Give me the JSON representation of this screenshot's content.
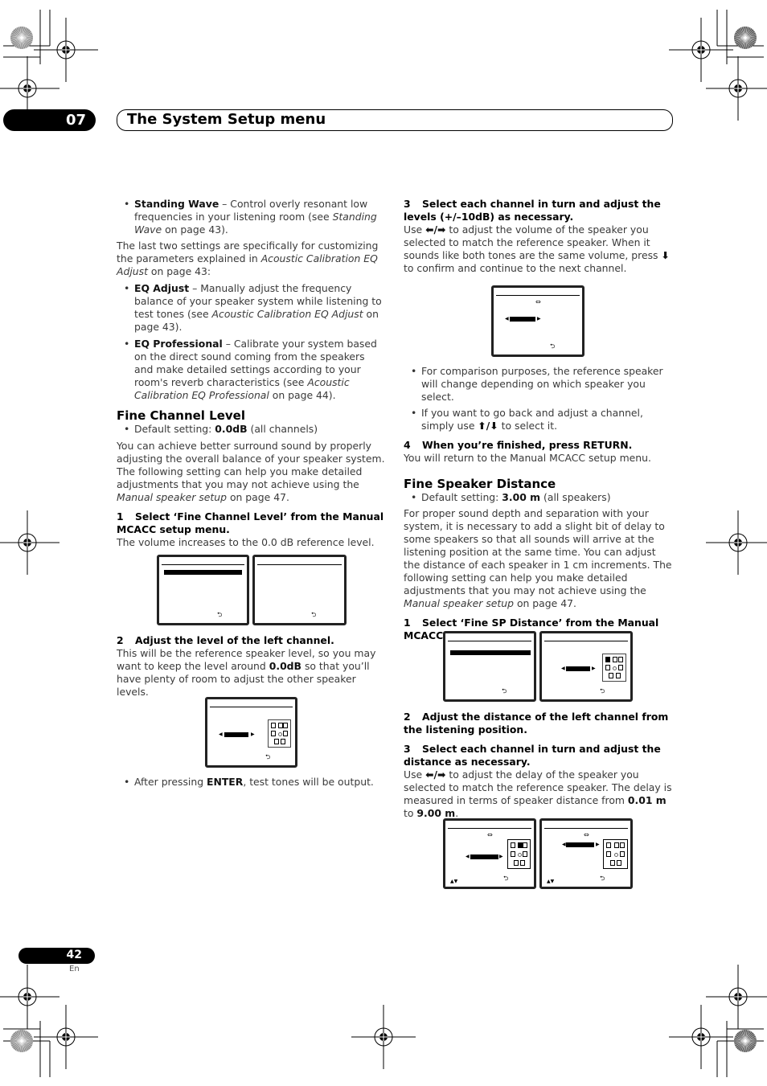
{
  "header": {
    "chapter_number": "07",
    "chapter_title": "The System Setup menu"
  },
  "footer": {
    "page_number": "42",
    "language": "En"
  },
  "left_column": {
    "bullets_top": [
      {
        "bold": "Standing Wave",
        "text": " – Control overly resonant low frequencies in your listening room (see ",
        "ital": "Standing Wave",
        "tail": " on page 43)."
      }
    ],
    "para_last_two": {
      "text": "The last two settings are specifically for customizing the parameters explained in ",
      "ital": "Acoustic Calibration EQ Adjust",
      "tail": " on page 43:"
    },
    "bullets_eq": [
      {
        "bold": "EQ Adjust",
        "text": " – Manually adjust the frequency balance of your speaker system while listening to test tones (see ",
        "ital": "Acoustic Calibration EQ Adjust",
        "tail": " on page 43)."
      },
      {
        "bold": "EQ Professional",
        "text": " – Calibrate your system based on the direct sound coming from the speakers and make detailed settings according to your room's reverb characteristics (see ",
        "ital": "Acoustic Calibration EQ Professional",
        "tail": " on page 44)."
      }
    ],
    "fine_channel_level": {
      "heading": "Fine Channel Level",
      "default_label": "Default setting: ",
      "default_value": "0.0dB",
      "default_tail": " (all channels)",
      "intro": "You can achieve better surround sound by properly adjusting the overall balance of your speaker system. The following setting can help you make detailed adjustments that you may not achieve using the ",
      "intro_ital": "Manual speaker setup",
      "intro_tail": " on page 47.",
      "step1_num": "1",
      "step1_title": "Select ‘Fine Channel Level’ from the Manual MCACC setup menu.",
      "step1_text": "The volume increases to the 0.0 dB reference level.",
      "step2_num": "2",
      "step2_title": "Adjust the level of the left channel.",
      "step2_text": "This will be the reference speaker level, so you may want to keep the level around ",
      "step2_bold": "0.0dB",
      "step2_tail": " so that you’ll have plenty of room to adjust the other speaker levels.",
      "after_bullet_pre": "After pressing ",
      "after_bullet_bold": "ENTER",
      "after_bullet_tail": ", test tones will be output."
    }
  },
  "right_column": {
    "step3_num": "3",
    "step3_title": "Select each channel in turn and adjust the levels (+/–10dB) as necessary.",
    "step3_pre": "Use ",
    "step3_keys": "⬅/➡",
    "step3_text": " to adjust the volume of the speaker you selected to match the reference speaker. When it sounds like both tones are the same volume, press ",
    "step3_key2": "⬇",
    "step3_tail": " to confirm and continue to the next channel.",
    "bullets": [
      {
        "text": "For comparison purposes, the reference speaker will change depending on which speaker you select."
      },
      {
        "pre": "If you want to go back and adjust a channel, simply use ",
        "keys": "⬆/⬇",
        "tail": " to select it."
      }
    ],
    "step4_num": "4",
    "step4_title": "When you’re finished, press RETURN.",
    "step4_text": "You will return to the Manual MCACC setup menu.",
    "fine_speaker_distance": {
      "heading": "Fine Speaker Distance",
      "default_label": "Default setting: ",
      "default_value": "3.00 m",
      "default_tail": " (all speakers)",
      "intro": "For proper sound depth and separation with your system, it is necessary to add a slight bit of delay to some speakers so that all sounds will arrive at the listening position at the same time. You can adjust the distance of each speaker in 1 cm increments. The following setting can help you make detailed adjustments that you may not achieve using the ",
      "intro_ital": "Manual speaker setup",
      "intro_tail": " on page 47.",
      "step1_num": "1",
      "step1_title": "Select ‘Fine SP Distance’ from the Manual MCACC setup menu.",
      "step2_num": "2",
      "step2_title": "Adjust the distance of the left channel from the listening position.",
      "step3_num": "3",
      "step3_title": "Select each channel in turn and adjust the distance as necessary.",
      "step3_pre": "Use ",
      "step3_keys": "⬅/➡",
      "step3_text": " to adjust the delay of the speaker you selected to match the reference speaker. The delay is measured in terms of speaker distance from ",
      "step3_min": "0.01 m",
      "step3_mid": " to ",
      "step3_max": "9.00 m",
      "step3_tail": "."
    }
  },
  "icons": {
    "return": "⮌",
    "left_tri": "◀",
    "right_tri": "▶",
    "swap": "⇔",
    "updown": "▲▼"
  }
}
